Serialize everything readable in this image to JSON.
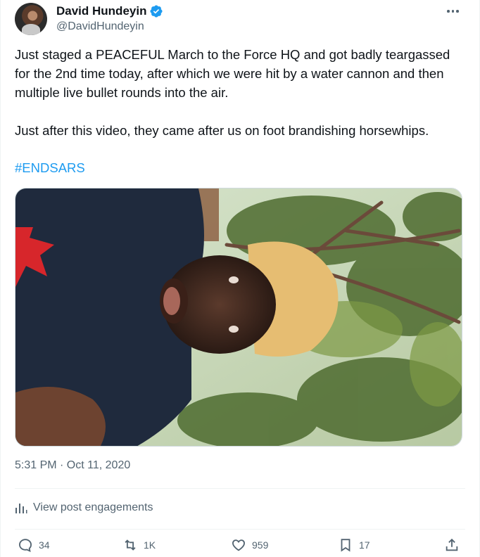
{
  "author": {
    "display_name": "David Hundeyin",
    "handle": "@DavidHundeyin",
    "verified_icon": "verified-badge-icon"
  },
  "tweet": {
    "text": "Just staged a PEACEFUL March to the Force HQ and got badly teargassed for the 2nd time today, after which we were hit by a water cannon and then multiple live bullet rounds into the air.\n\nJust after this video, they came after us on foot brandishing horsewhips.",
    "hashtag": "#ENDSARS",
    "timestamp": "5:31 PM · Oct 11, 2020"
  },
  "engagements_label": "View post engagements",
  "actions": {
    "replies": "34",
    "reposts": "1K",
    "likes": "959",
    "bookmarks": "17"
  },
  "colors": {
    "accent": "#1d9bf0",
    "secondary_text": "#536471",
    "primary_text": "#0f1419"
  }
}
